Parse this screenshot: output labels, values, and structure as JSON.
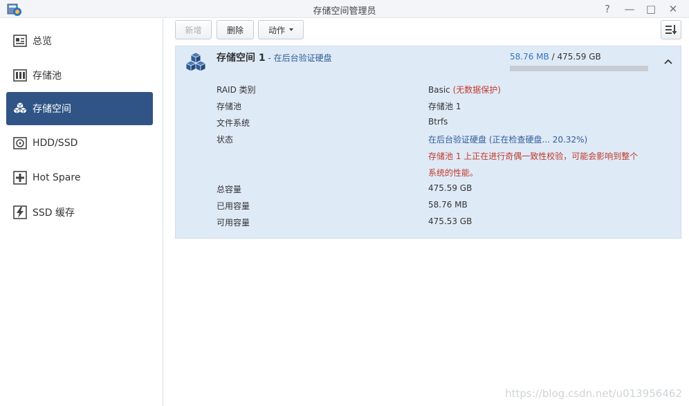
{
  "window": {
    "title": "存储空间管理员",
    "help_icon": "?",
    "minimize_icon": "—",
    "maximize_icon": "□",
    "close_icon": "✕"
  },
  "sidebar": {
    "items": [
      {
        "label": "总览",
        "icon": "overview-card-icon"
      },
      {
        "label": "存储池",
        "icon": "storage-pool-icon"
      },
      {
        "label": "存储空间",
        "icon": "volume-cubes-icon",
        "active": true
      },
      {
        "label": "HDD/SSD",
        "icon": "hdd-icon"
      },
      {
        "label": "Hot Spare",
        "icon": "hot-spare-icon"
      },
      {
        "label": "SSD 缓存",
        "icon": "ssd-cache-icon"
      }
    ]
  },
  "toolbar": {
    "create_label": "新增",
    "delete_label": "删除",
    "action_label": "动作"
  },
  "volume": {
    "name": "存储空间 1",
    "separator": " - ",
    "status_short": "在后台验证硬盘",
    "used": "58.76 MB",
    "usage_sep": " / ",
    "total": "475.59 GB",
    "usage_fraction": 0.0001,
    "raid_label": "RAID 类别",
    "raid_value": "Basic",
    "raid_note": "(无数据保护)",
    "pool_label": "存储池",
    "pool_value": "存储池 1",
    "fs_label": "文件系统",
    "fs_value": "Btrfs",
    "status_label": "状态",
    "status_value": "在后台验证硬盘 (正在检查硬盘... 20.32%)",
    "warning_line1": "存储池 1 上正在进行奇偶一致性校验，可能会影响到整个",
    "warning_line2": "系统的性能。",
    "capacity_label": "总容量",
    "capacity_value": "475.59 GB",
    "used_label": "已用容量",
    "used_value": "58.76 MB",
    "free_label": "可用容量",
    "free_value": "475.53 GB"
  },
  "watermark": "https://blog.csdn.net/u013956462",
  "colors": {
    "accent": "#2f5485",
    "panel_bg": "#dfeaf7",
    "warning": "#c0392b",
    "usage": "#2f74c4"
  }
}
